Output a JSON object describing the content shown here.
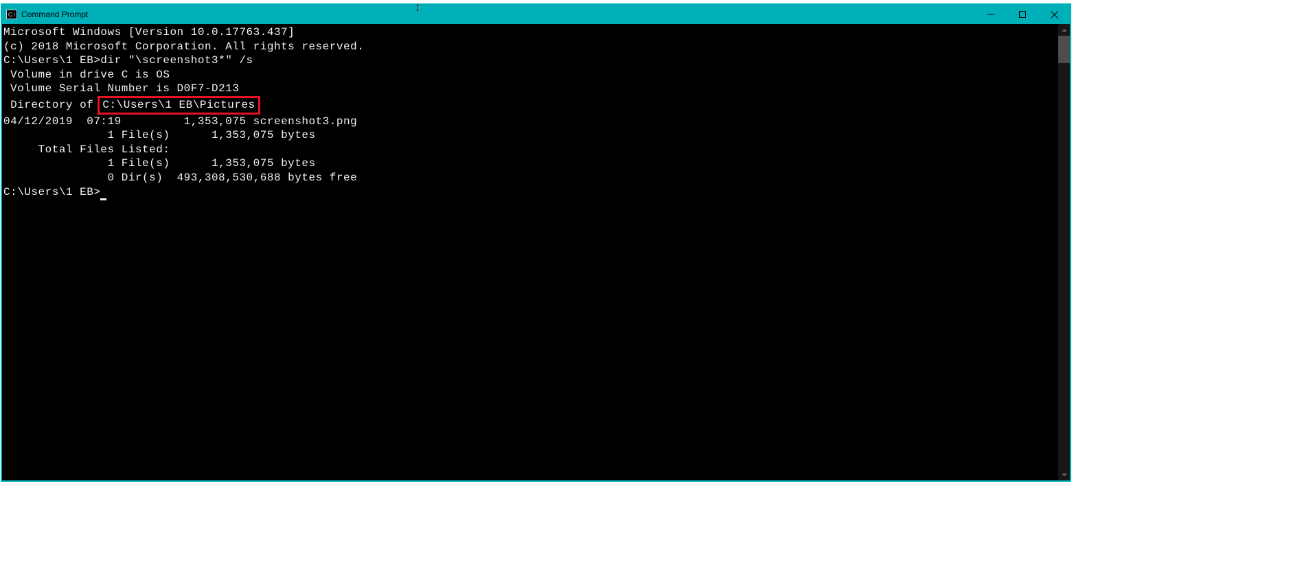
{
  "window": {
    "title": "Command Prompt"
  },
  "cursor_marker": "↕",
  "terminal": {
    "line1": "Microsoft Windows [Version 10.0.17763.437]",
    "line2": "(c) 2018 Microsoft Corporation. All rights reserved.",
    "blank1": "",
    "prompt1": "C:\\Users\\1 EB>dir \"\\screenshot3*\" /s",
    "vol1": " Volume in drive C is OS",
    "vol2": " Volume Serial Number is D0F7-D213",
    "blank2": "",
    "dir_prefix": " Directory of ",
    "dir_path": "C:\\Users\\1 EB\\Pictures",
    "blank3": "",
    "file_row": "04/12/2019  07:19         1,353,075 screenshot3.png",
    "file_sum": "               1 File(s)      1,353,075 bytes",
    "blank4": "",
    "total_hdr": "     Total Files Listed:",
    "total_files": "               1 File(s)      1,353,075 bytes",
    "total_dirs": "               0 Dir(s)  493,308,530,688 bytes free",
    "blank5": "",
    "prompt2": "C:\\Users\\1 EB>"
  },
  "annotation": {
    "highlighted_path": "C:\\Users\\1 EB\\Pictures"
  }
}
